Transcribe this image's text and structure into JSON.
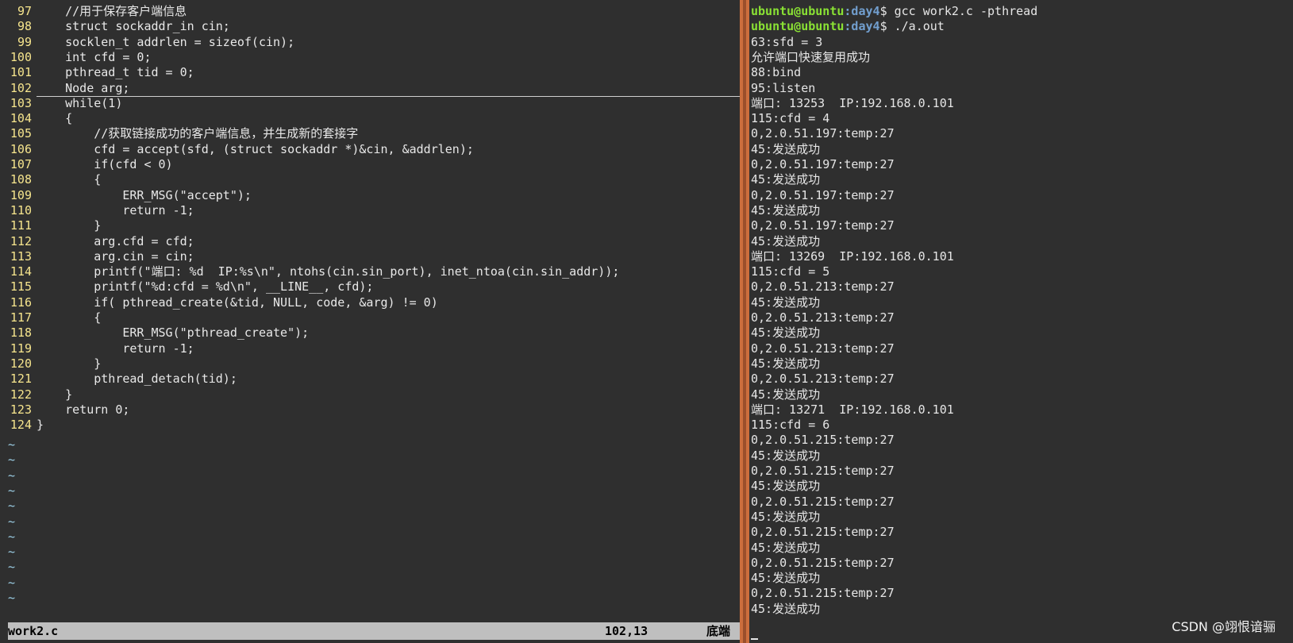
{
  "editor": {
    "code_lines": [
      {
        "number": "97",
        "text": "    //用于保存客户端信息"
      },
      {
        "number": "98",
        "text": "    struct sockaddr_in cin;"
      },
      {
        "number": "99",
        "text": "    socklen_t addrlen = sizeof(cin);"
      },
      {
        "number": "100",
        "text": "    int cfd = 0;"
      },
      {
        "number": "101",
        "text": "    pthread_t tid = 0;"
      },
      {
        "number": "102",
        "text": "    Node arg;"
      },
      {
        "number": "103",
        "text": "    while(1)"
      },
      {
        "number": "104",
        "text": "    {"
      },
      {
        "number": "105",
        "text": "        //获取链接成功的客户端信息，并生成新的套接字"
      },
      {
        "number": "106",
        "text": "        cfd = accept(sfd, (struct sockaddr *)&cin, &addrlen);"
      },
      {
        "number": "107",
        "text": "        if(cfd < 0)"
      },
      {
        "number": "108",
        "text": "        {"
      },
      {
        "number": "109",
        "text": "            ERR_MSG(\"accept\");"
      },
      {
        "number": "110",
        "text": "            return -1;"
      },
      {
        "number": "111",
        "text": "        }"
      },
      {
        "number": "112",
        "text": "        arg.cfd = cfd;"
      },
      {
        "number": "113",
        "text": "        arg.cin = cin;"
      },
      {
        "number": "114",
        "text": "        printf(\"端口: %d  IP:%s\\n\", ntohs(cin.sin_port), inet_ntoa(cin.sin_addr));"
      },
      {
        "number": "115",
        "text": "        printf(\"%d:cfd = %d\\n\", __LINE__, cfd);"
      },
      {
        "number": "116",
        "text": "        if( pthread_create(&tid, NULL, code, &arg) != 0)"
      },
      {
        "number": "117",
        "text": "        {"
      },
      {
        "number": "118",
        "text": "            ERR_MSG(\"pthread_create\");"
      },
      {
        "number": "119",
        "text": "            return -1;"
      },
      {
        "number": "120",
        "text": "        }"
      },
      {
        "number": "121",
        "text": "        pthread_detach(tid);"
      },
      {
        "number": "122",
        "text": "    }"
      },
      {
        "number": "123",
        "text": "    return 0;"
      },
      {
        "number": "124",
        "text": "}"
      }
    ],
    "empty_marker": "~",
    "status": {
      "filename": "work2.c",
      "cursor_position": "102,13",
      "scroll_position": "底端"
    }
  },
  "terminal": {
    "prompt_lines": [
      {
        "user": "ubuntu@ubuntu",
        "path": ":day4",
        "command": "$ gcc work2.c -pthread"
      },
      {
        "user": "ubuntu@ubuntu",
        "path": ":day4",
        "command": "$ ./a.out"
      }
    ],
    "output_lines": [
      "63:sfd = 3",
      "允许端口快速复用成功",
      "88:bind",
      "95:listen",
      "端口: 13253  IP:192.168.0.101",
      "115:cfd = 4",
      "0,2.0.51.197:temp:27",
      "45:发送成功",
      "0,2.0.51.197:temp:27",
      "45:发送成功",
      "0,2.0.51.197:temp:27",
      "45:发送成功",
      "0,2.0.51.197:temp:27",
      "45:发送成功",
      "端口: 13269  IP:192.168.0.101",
      "115:cfd = 5",
      "0,2.0.51.213:temp:27",
      "45:发送成功",
      "0,2.0.51.213:temp:27",
      "45:发送成功",
      "0,2.0.51.213:temp:27",
      "45:发送成功",
      "0,2.0.51.213:temp:27",
      "45:发送成功",
      "端口: 13271  IP:192.168.0.101",
      "115:cfd = 6",
      "0,2.0.51.215:temp:27",
      "45:发送成功",
      "0,2.0.51.215:temp:27",
      "45:发送成功",
      "0,2.0.51.215:temp:27",
      "45:发送成功",
      "0,2.0.51.215:temp:27",
      "45:发送成功",
      "0,2.0.51.215:temp:27",
      "45:发送成功",
      "0,2.0.51.215:temp:27",
      "45:发送成功"
    ]
  },
  "watermark": "CSDN @翊恨谙骊",
  "colors": {
    "background": "#2f2f2f",
    "line_number": "#f6e58d",
    "prompt_user": "#8ae234",
    "prompt_path": "#729fcf",
    "divider": "#cc6e3d",
    "status_bar": "#bfbfbf"
  }
}
